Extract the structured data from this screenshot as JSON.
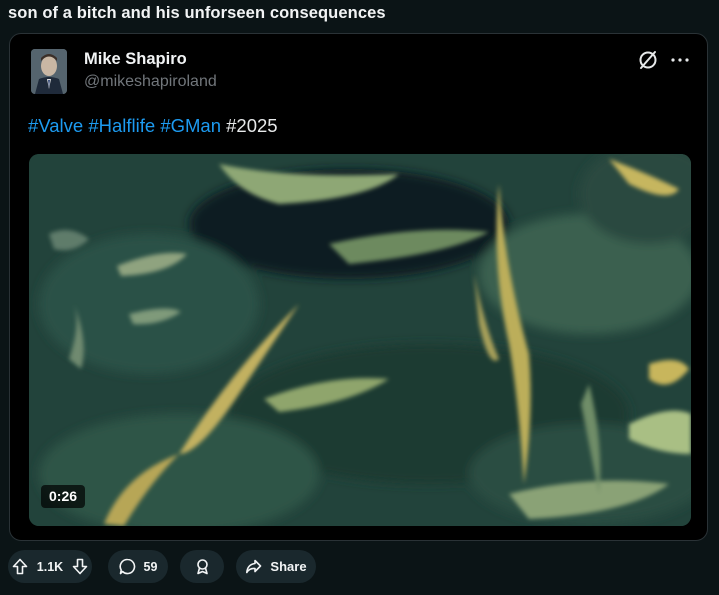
{
  "post": {
    "title": "son of a bitch and his unforseen consequences"
  },
  "embed": {
    "author_name": "Mike Shapiro",
    "author_handle": "@mikeshapiroland",
    "hashtags": [
      "#Valve",
      "#Halflife",
      "#GMan"
    ],
    "plain_tag": "#2025",
    "video": {
      "duration": "0:26"
    },
    "icons": {
      "platform": "x-no-entry-icon",
      "more": "more-dots-icon"
    }
  },
  "actions": {
    "vote_count": "1.1K",
    "comment_count": "59",
    "share_label": "Share"
  },
  "colors": {
    "background": "#0b1416",
    "card": "#000000",
    "hashtag": "#1d9bf0",
    "pill": "#1a282d",
    "handle": "#71767b"
  }
}
